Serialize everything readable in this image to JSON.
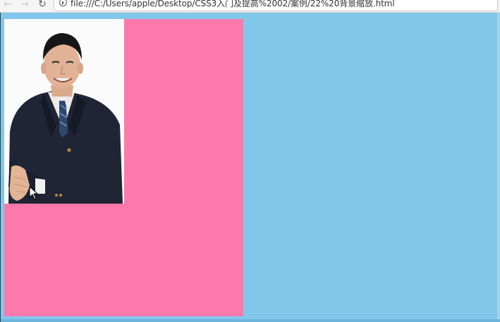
{
  "browser": {
    "url": "file:///C:/Users/apple/Desktop/CSS3入门及提高%2002/案例/22%20背景缩放.html",
    "back_glyph": "←",
    "forward_glyph": "→",
    "reload_glyph": "↻"
  },
  "page": {
    "background_color": "#81c7ea",
    "demo_box": {
      "background_color": "#fd79ac",
      "image": "portrait-photo"
    }
  },
  "icons": {
    "back": "arrow-left-icon",
    "forward": "arrow-right-icon",
    "reload": "reload-icon",
    "info": "info-icon",
    "cursor": "mouse-pointer-icon"
  }
}
